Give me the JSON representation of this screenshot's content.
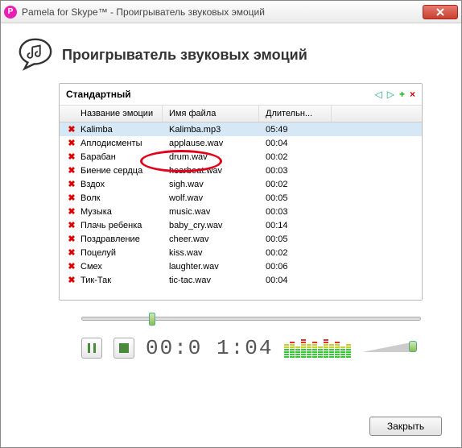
{
  "window": {
    "app_icon_letter": "P",
    "title": "Pamela for Skype™ - Проигрыватель звуковых эмоций"
  },
  "header": {
    "title": "Проигрыватель звуковых эмоций"
  },
  "panel": {
    "tab_name": "Стандартный",
    "columns": {
      "name": "Название эмоции",
      "file": "Имя файла",
      "duration": "Длительн..."
    },
    "rows": [
      {
        "name": "Kalimba",
        "file": "Kalimba.mp3",
        "duration": "05:49",
        "selected": true
      },
      {
        "name": "Аплодисменты",
        "file": "applause.wav",
        "duration": "00:04"
      },
      {
        "name": "Барабан",
        "file": "drum.wav",
        "duration": "00:02"
      },
      {
        "name": "Биение сердца",
        "file": "hearbeat.wav",
        "duration": "00:03"
      },
      {
        "name": "Вздох",
        "file": "sigh.wav",
        "duration": "00:02"
      },
      {
        "name": "Волк",
        "file": "wolf.wav",
        "duration": "00:05"
      },
      {
        "name": "Музыка",
        "file": "music.wav",
        "duration": "00:03"
      },
      {
        "name": "Плачь ребенка",
        "file": "baby_cry.wav",
        "duration": "00:14"
      },
      {
        "name": "Поздравление",
        "file": "cheer.wav",
        "duration": "00:05"
      },
      {
        "name": "Поцелуй",
        "file": "kiss.wav",
        "duration": "00:02"
      },
      {
        "name": "Смех",
        "file": "laughter.wav",
        "duration": "00:06"
      },
      {
        "name": "Тик-Так",
        "file": "tic-tac.wav",
        "duration": "00:04"
      }
    ]
  },
  "player": {
    "time_display": "00:0 1:04"
  },
  "footer": {
    "close_label": "Закрыть"
  }
}
